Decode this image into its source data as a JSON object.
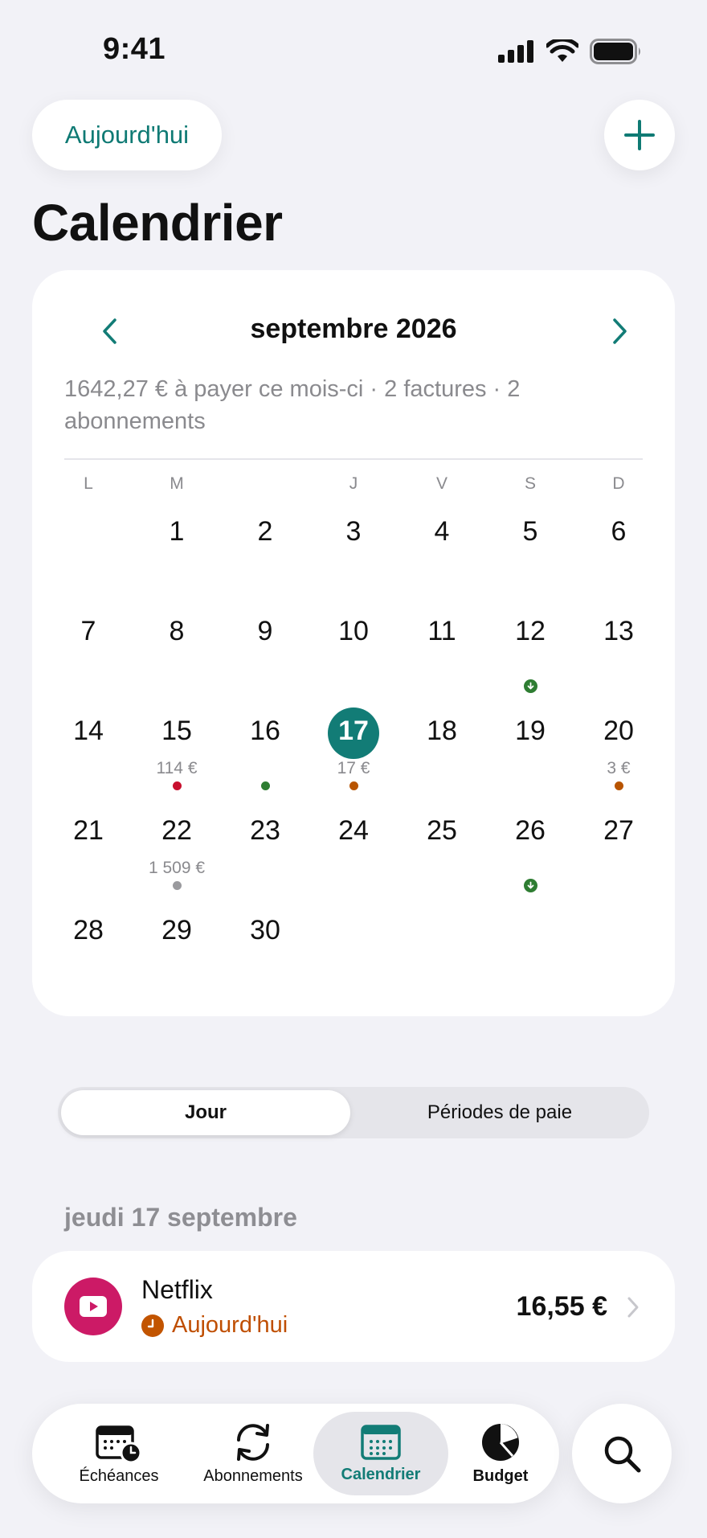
{
  "status_bar": {
    "time": "9:41"
  },
  "header": {
    "today_button": "Aujourd'hui",
    "add_button_icon": "plus-icon",
    "title": "Calendrier"
  },
  "calendar": {
    "month_title": "septembre 2026",
    "summary": "1642,27 € à payer ce mois-ci · 2 factures · 2 abonnements",
    "weekdays": [
      "L",
      "M",
      "",
      "J",
      "V",
      "S",
      "D"
    ],
    "selected_day": "17",
    "weeks": [
      [
        null,
        {
          "d": "1"
        },
        {
          "d": "2"
        },
        {
          "d": "3"
        },
        {
          "d": "4"
        },
        {
          "d": "5"
        },
        {
          "d": "6"
        }
      ],
      [
        {
          "d": "7"
        },
        {
          "d": "8"
        },
        {
          "d": "9"
        },
        {
          "d": "10"
        },
        {
          "d": "11"
        },
        {
          "d": "12",
          "marker": "green-down"
        },
        {
          "d": "13"
        }
      ],
      [
        {
          "d": "14"
        },
        {
          "d": "15",
          "amount": "114 €",
          "marker": "red"
        },
        {
          "d": "16",
          "marker": "green"
        },
        {
          "d": "17",
          "amount": "17 €",
          "marker": "orange",
          "selected": true
        },
        {
          "d": "18"
        },
        {
          "d": "19"
        },
        {
          "d": "20",
          "amount": "3 €",
          "marker": "orange"
        }
      ],
      [
        {
          "d": "21"
        },
        {
          "d": "22",
          "amount": "1 509 €",
          "marker": "gray"
        },
        {
          "d": "23"
        },
        {
          "d": "24"
        },
        {
          "d": "25"
        },
        {
          "d": "26",
          "marker": "green-down"
        },
        {
          "d": "27"
        }
      ],
      [
        {
          "d": "28"
        },
        {
          "d": "29"
        },
        {
          "d": "30"
        },
        null,
        null,
        null,
        null
      ]
    ],
    "colors": {
      "accent": "#127c76",
      "red": "#c8102e",
      "orange": "#b85400",
      "green": "#2e7d32",
      "gray": "#9a9a9e"
    }
  },
  "segments": {
    "active": "Jour",
    "inactive": "Périodes de paie"
  },
  "section_date": "jeudi 17 septembre",
  "event": {
    "name": "Netflix",
    "status": "Aujourd'hui",
    "amount": "16,55 €",
    "logo_icon": "play-icon"
  },
  "tabbar": {
    "tabs": [
      {
        "label": "Échéances",
        "icon": "calendar-clock-icon"
      },
      {
        "label": "Abonnements",
        "icon": "refresh-icon"
      },
      {
        "label": "Calendrier",
        "icon": "calendar-grid-icon",
        "active": true
      },
      {
        "label": "Budget",
        "icon": "pie-chart-icon"
      }
    ],
    "search_icon": "search-icon"
  }
}
